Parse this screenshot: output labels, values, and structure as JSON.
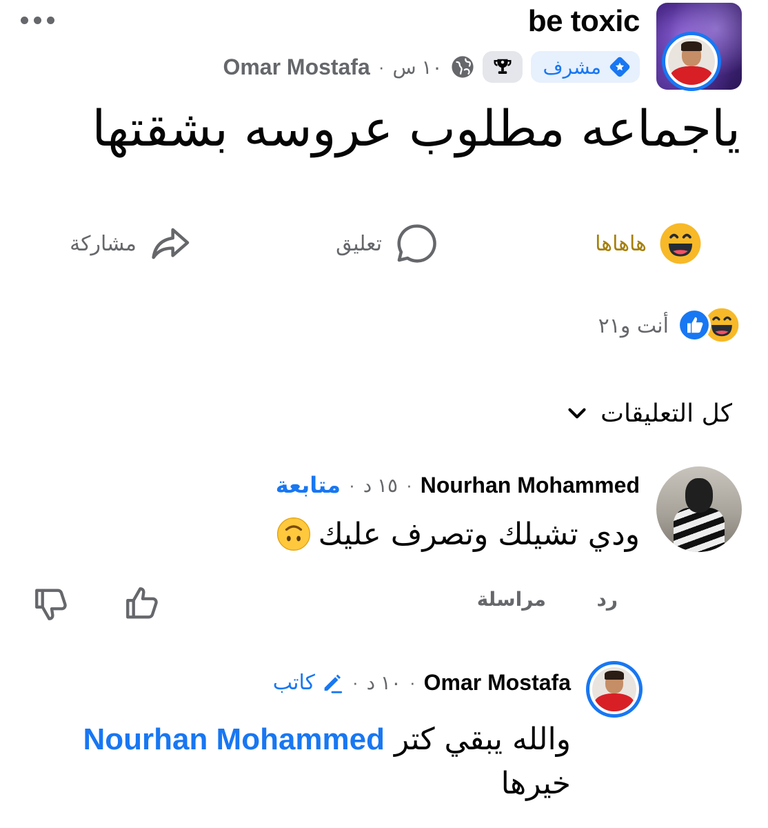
{
  "post": {
    "group_name": "be toxic",
    "author": "Omar Mostafa",
    "time": "١٠ س",
    "separator": "·",
    "admin_badge": "مشرف",
    "text": "ياجماعه مطلوب عروسه بشقتها"
  },
  "actions": {
    "reaction_label": "هاهاها",
    "comment_label": "تعليق",
    "share_label": "مشاركة"
  },
  "reactions": {
    "summary": "أنت و٢١"
  },
  "comments_filter": {
    "label": "كل التعليقات"
  },
  "comments": [
    {
      "author": "Nourhan Mohammed",
      "time": "١٥ د",
      "follow_label": "متابعة",
      "text": "ودي تشيلك وتصرف عليك",
      "emoji": "🙃",
      "reply_label": "رد",
      "message_label": "مراسلة"
    },
    {
      "author": "Omar Mostafa",
      "time": "١٠ د",
      "author_badge": "كاتب",
      "text_before": "والله يبقي كتر",
      "mention": "Nourhan Mohammed",
      "text_after": "خيرها"
    }
  ],
  "icons": {
    "more": "more-horizontal-icon",
    "globe": "globe-icon",
    "trophy": "trophy-icon",
    "admin_shield": "admin-star-icon",
    "haha": "haha-reaction-icon",
    "like": "like-reaction-icon",
    "comment": "comment-bubble-icon",
    "share": "share-arrow-icon",
    "chevron": "chevron-down-icon",
    "thumb_up": "thumb-up-icon",
    "thumb_down": "thumb-down-icon",
    "pencil": "pencil-icon"
  },
  "colors": {
    "accent": "#1877f2",
    "muted": "#65676b",
    "haha_label": "#a5800d",
    "reaction_yellow": "#f7b928"
  }
}
